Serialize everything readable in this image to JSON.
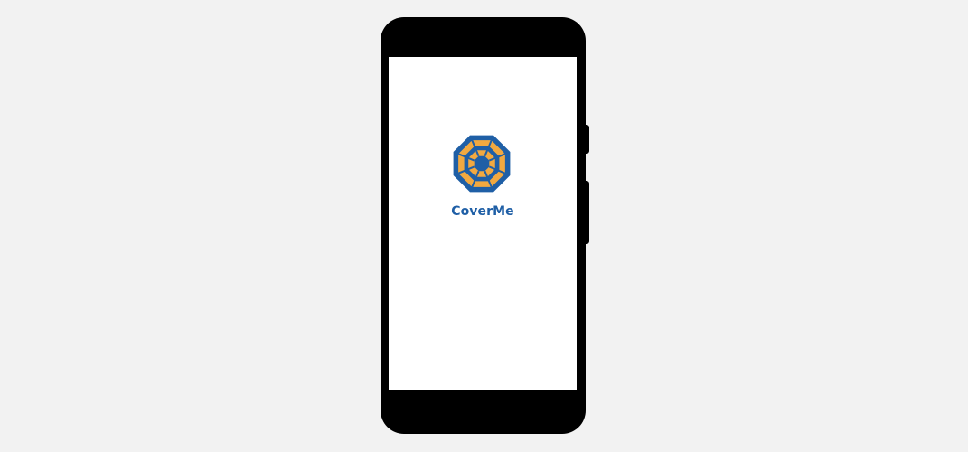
{
  "splash": {
    "app_name": "CoverMe",
    "logo_icon": "umbrella-top-icon"
  },
  "colors": {
    "background": "#f2f2f2",
    "phone_frame": "#000000",
    "screen": "#ffffff",
    "brand_blue": "#1f5fa6",
    "brand_orange": "#f2a940"
  }
}
